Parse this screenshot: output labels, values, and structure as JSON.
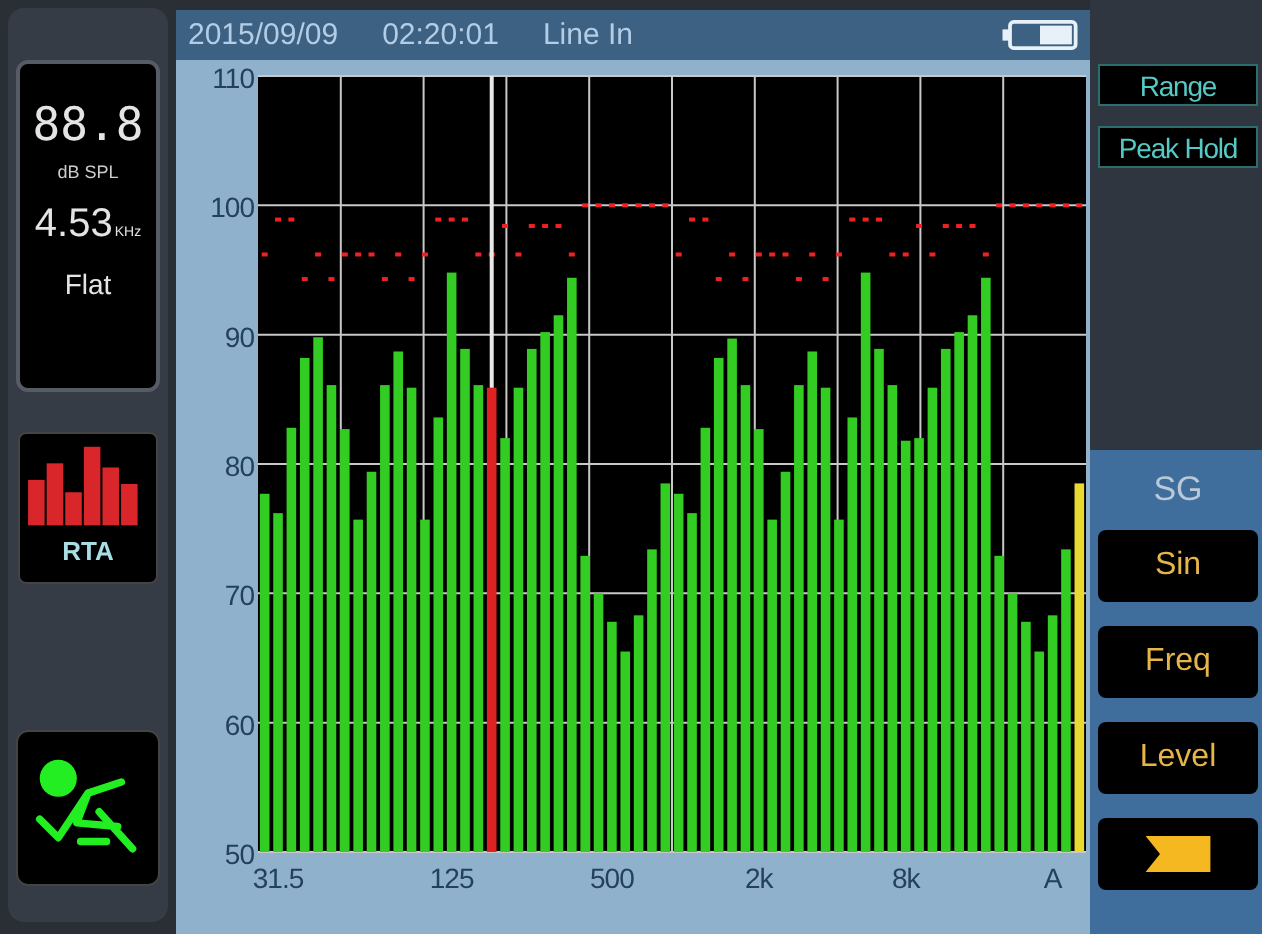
{
  "status_bar": {
    "date": "2015/09/09",
    "time": "02:20:01",
    "input": "Line In"
  },
  "readout": {
    "level": "88.8",
    "level_unit": "dB SPL",
    "frequency": "4.53",
    "frequency_unit": "KHz",
    "weighting": "Flat"
  },
  "mode_button": {
    "label": "RTA"
  },
  "side_buttons": [
    {
      "label": "Range"
    },
    {
      "label": "Peak Hold"
    }
  ],
  "signal_generator": {
    "title": "SG",
    "buttons": [
      {
        "label": "Sin"
      },
      {
        "label": "Freq"
      },
      {
        "label": "Level"
      }
    ]
  },
  "chart_data": {
    "type": "bar",
    "categories": [
      null,
      "31.5",
      null,
      null,
      null,
      null,
      null,
      null,
      null,
      null,
      null,
      null,
      null,
      null,
      "125",
      null,
      null,
      null,
      null,
      null,
      null,
      null,
      null,
      null,
      null,
      null,
      "500",
      null,
      null,
      null,
      null,
      null,
      null,
      null,
      null,
      null,
      null,
      "2k",
      null,
      null,
      null,
      null,
      null,
      null,
      null,
      null,
      null,
      null,
      "8k",
      null,
      null,
      null,
      null,
      null,
      null,
      null,
      null,
      null,
      null,
      "A",
      null,
      null
    ],
    "grid": true,
    "ylim": [
      50,
      110
    ],
    "yticks": [
      50,
      60,
      70,
      80,
      90,
      100,
      110
    ],
    "series": [
      {
        "color": "#33cc22",
        "values": [
          77.7,
          76.2,
          82.8,
          88.2,
          89.8,
          86.1,
          82.7,
          75.7,
          79.4,
          86.1,
          88.7,
          85.9,
          75.7,
          83.6,
          94.8,
          88.9,
          86.1,
          null,
          82.0,
          85.9,
          88.9,
          90.2,
          91.5,
          94.4,
          72.9,
          70.0,
          67.8,
          65.5,
          68.3,
          73.4,
          78.5,
          77.7,
          76.2,
          82.8,
          88.2,
          89.7,
          86.1,
          82.7,
          75.7,
          79.4,
          86.1,
          88.7,
          85.9,
          75.7,
          83.6,
          94.8,
          88.9,
          86.1,
          81.8,
          82.0,
          85.9,
          88.9,
          90.2,
          91.5,
          94.4,
          72.9,
          70.0,
          67.8,
          65.5,
          68.3,
          73.4,
          null
        ]
      },
      {
        "color": "#dd2222",
        "values": [
          null,
          null,
          null,
          null,
          null,
          null,
          null,
          null,
          null,
          null,
          null,
          null,
          null,
          null,
          null,
          null,
          null,
          85.9,
          null,
          null,
          null,
          null,
          null,
          null,
          null,
          null,
          null,
          null,
          null,
          null,
          null,
          null,
          null,
          null,
          null,
          null,
          null,
          null,
          null,
          null,
          null,
          null,
          null,
          null,
          null,
          null,
          null,
          null,
          null,
          null,
          null,
          null,
          null,
          null,
          null,
          null,
          null,
          null,
          null,
          null,
          null,
          null
        ]
      },
      {
        "color": "#e8d830",
        "values": [
          null,
          null,
          null,
          null,
          null,
          null,
          null,
          null,
          null,
          null,
          null,
          null,
          null,
          null,
          null,
          null,
          null,
          null,
          null,
          null,
          null,
          null,
          null,
          null,
          null,
          null,
          null,
          null,
          null,
          null,
          null,
          null,
          null,
          null,
          null,
          null,
          null,
          null,
          null,
          null,
          null,
          null,
          null,
          null,
          null,
          null,
          null,
          null,
          null,
          null,
          null,
          null,
          null,
          null,
          null,
          null,
          null,
          null,
          null,
          null,
          null,
          78.5
        ]
      },
      {
        "type": "scatter",
        "color": "#ee2222",
        "values": [
          96.2,
          98.9,
          98.9,
          94.3,
          96.2,
          94.3,
          96.2,
          96.2,
          96.2,
          94.3,
          96.2,
          94.3,
          96.2,
          98.9,
          98.9,
          98.9,
          96.2,
          96.2,
          98.4,
          96.2,
          98.4,
          98.4,
          98.4,
          96.2,
          100,
          100,
          100,
          100,
          100,
          100,
          100,
          96.2,
          98.9,
          98.9,
          94.3,
          96.2,
          94.3,
          96.2,
          96.2,
          96.2,
          94.3,
          96.2,
          94.3,
          96.2,
          98.9,
          98.9,
          98.9,
          96.2,
          96.2,
          98.4,
          96.2,
          98.4,
          98.4,
          98.4,
          96.2,
          100,
          100,
          100,
          100,
          100,
          100,
          100
        ]
      }
    ]
  }
}
